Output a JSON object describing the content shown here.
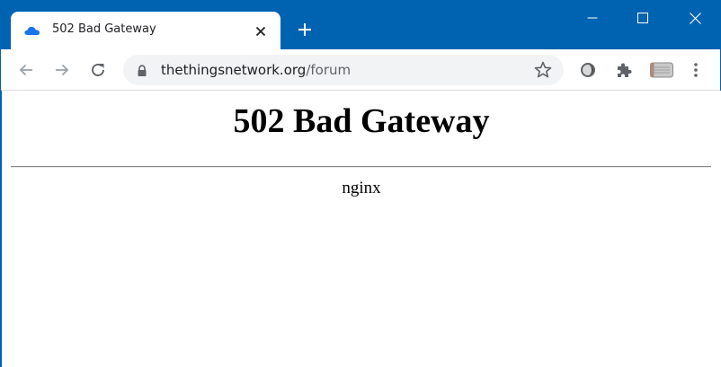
{
  "browser": {
    "tab": {
      "title": "502 Bad Gateway",
      "favicon": "cloud-icon",
      "favicon_color": "#1a73e8"
    },
    "new_tab_icon": "plus-icon",
    "window_controls": [
      "minimize-icon",
      "maximize-icon",
      "close-icon"
    ],
    "titlebar_color": "#0063b1",
    "toolbar": {
      "back_icon": "arrow-left-icon",
      "forward_icon": "arrow-right-icon",
      "reload_icon": "reload-icon",
      "address": {
        "host": "thethingsnetwork.org",
        "path": "/forum",
        "lock_icon": "lock-icon",
        "bookmark_icon": "star-icon"
      },
      "extensions": [
        "extension-circle-icon",
        "puzzle-icon",
        "profile-avatar-icon",
        "kebab-menu-icon"
      ]
    }
  },
  "page": {
    "heading": "502 Bad Gateway",
    "server": "nginx"
  }
}
